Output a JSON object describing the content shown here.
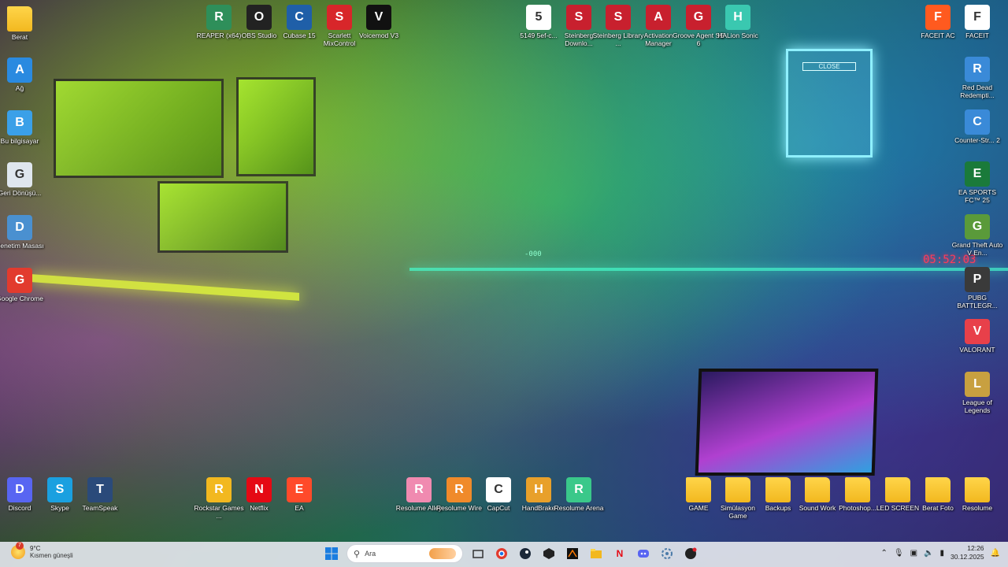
{
  "desktop": {
    "left_column": [
      {
        "label": "Berat",
        "icon": "folder-icon",
        "kind": "folder"
      },
      {
        "label": "Ağ",
        "icon": "network-icon",
        "color": "#2a8ae0"
      },
      {
        "label": "Bu bilgisayar",
        "icon": "computer-icon",
        "color": "#3aa0e8"
      },
      {
        "label": "Geri Dönüşü...",
        "icon": "recycle-bin-icon",
        "color": "#dfe6ee"
      },
      {
        "label": "Denetim Masası",
        "icon": "control-panel-icon",
        "color": "#4a90d0"
      },
      {
        "label": "Google Chrome",
        "icon": "chrome-icon",
        "color": "#e23b2e"
      }
    ],
    "top_row": [
      {
        "label": "REAPER (x64)",
        "icon": "reaper-icon",
        "color": "#2e8f5a"
      },
      {
        "label": "OBS Studio",
        "icon": "obs-icon",
        "color": "#222222"
      },
      {
        "label": "Cubase 15",
        "icon": "cubase-icon",
        "color": "#1f5fa8"
      },
      {
        "label": "Scarlett MixControl",
        "icon": "scarlett-icon",
        "color": "#d8262a"
      },
      {
        "label": "Voicemod V3",
        "icon": "voicemod-icon",
        "color": "#111111"
      }
    ],
    "top_right_row": [
      {
        "label": "5149 5ef-c...",
        "icon": "file-icon",
        "color": "#ffffff"
      },
      {
        "label": "Steinberg Downlo...",
        "icon": "steinberg-download-icon",
        "color": "#c8202e"
      },
      {
        "label": "Steinberg Library ...",
        "icon": "steinberg-library-icon",
        "color": "#c8202e"
      },
      {
        "label": "Activation Manager",
        "icon": "activation-manager-icon",
        "color": "#c8202e"
      },
      {
        "label": "Groove Agent SE 6",
        "icon": "groove-agent-icon",
        "color": "#c8202e"
      },
      {
        "label": "HALion Sonic",
        "icon": "halion-icon",
        "color": "#3ac8b0"
      }
    ],
    "far_right_top": [
      {
        "label": "FACEIT AC",
        "icon": "faceit-ac-icon",
        "color": "#ff5a1f"
      },
      {
        "label": "FACEIT",
        "icon": "faceit-file-icon",
        "color": "#ffffff"
      }
    ],
    "right_column": [
      {
        "label": "Red Dead Redempti...",
        "icon": "web-shortcut-icon",
        "color": "#3a8ad8"
      },
      {
        "label": "Counter-Str... 2",
        "icon": "web-shortcut-icon",
        "color": "#3a8ad8"
      },
      {
        "label": "EA SPORTS FC™ 25",
        "icon": "ea-fc-icon",
        "color": "#1a7a3a"
      },
      {
        "label": "Grand Theft Auto V En...",
        "icon": "gta-icon",
        "color": "#5a9a3a"
      },
      {
        "label": "PUBG BATTLEGR...",
        "icon": "pubg-icon",
        "color": "#3a3a3a"
      },
      {
        "label": "VALORANT",
        "icon": "valorant-icon",
        "color": "#e8404a"
      },
      {
        "label": "League of Legends",
        "icon": "lol-icon",
        "color": "#c8a040"
      }
    ],
    "bottom_left": [
      {
        "label": "Discord",
        "icon": "discord-icon",
        "color": "#5865f2"
      },
      {
        "label": "Skype",
        "icon": "skype-icon",
        "color": "#1aa0e0"
      },
      {
        "label": "TeamSpeak",
        "icon": "teamspeak-icon",
        "color": "#2a4a7a"
      }
    ],
    "bottom_mid": [
      {
        "label": "Rockstar Games ...",
        "icon": "rockstar-icon",
        "color": "#f2b81f"
      },
      {
        "label": "Netflix",
        "icon": "netflix-icon",
        "color": "#e50914"
      },
      {
        "label": "EA",
        "icon": "ea-icon",
        "color": "#ff4a2a"
      }
    ],
    "bottom_center": [
      {
        "label": "Resolume Alley",
        "icon": "resolume-alley-icon",
        "color": "#f08ab0"
      },
      {
        "label": "Resolume Wire",
        "icon": "resolume-wire-icon",
        "color": "#f08a2a"
      },
      {
        "label": "CapCut",
        "icon": "capcut-icon",
        "color": "#ffffff"
      },
      {
        "label": "HandBrake",
        "icon": "handbrake-icon",
        "color": "#e8a02a"
      },
      {
        "label": "Resolume Arena",
        "icon": "resolume-arena-icon",
        "color": "#3ac88a"
      }
    ],
    "bottom_folders": [
      {
        "label": "GAME"
      },
      {
        "label": "Simülasyon Game"
      },
      {
        "label": "Backups"
      },
      {
        "label": "Sound Work"
      },
      {
        "label": "Photoshop..."
      },
      {
        "label": "LED SCREEN"
      },
      {
        "label": "Berat Foto"
      },
      {
        "label": "Resolume"
      }
    ]
  },
  "taskbar": {
    "weather_temp": "9°C",
    "weather_desc": "Kısmen güneşli",
    "weather_badge": "7",
    "search_placeholder": "Ara",
    "time": "12:26",
    "date": "30.12.2025",
    "apps": [
      "start-icon",
      "search",
      "bubble-icon",
      "task-view-icon",
      "chrome-icon",
      "steam-icon",
      "unity-icon",
      "premiere-icon",
      "file-explorer-icon",
      "netflix-icon",
      "discord-icon",
      "settings-icon",
      "obs-icon"
    ]
  },
  "wallpaper": {
    "led_clock": "05:52:03",
    "led_display": "-000",
    "sign_text": "CLOSE"
  }
}
